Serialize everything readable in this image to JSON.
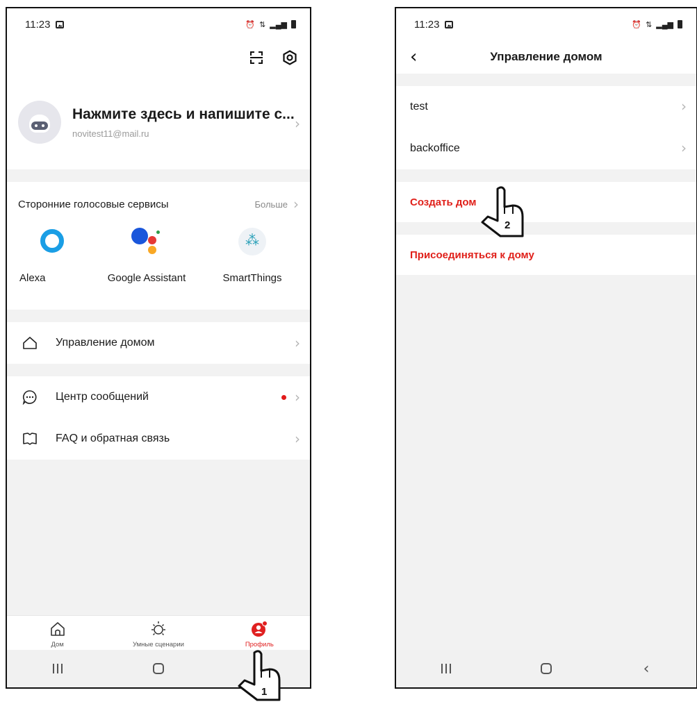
{
  "screen1": {
    "status": {
      "time": "11:23"
    },
    "profile": {
      "name": "Нажмите здесь и напишите с...",
      "email": "novitest11@mail.ru"
    },
    "voice": {
      "title": "Сторонние голосовые сервисы",
      "more": "Больше",
      "items": [
        {
          "label": "Alexa",
          "icon": "alexa-icon"
        },
        {
          "label": "Google Assistant",
          "icon": "google-assistant-icon"
        },
        {
          "label": "SmartThings",
          "icon": "smartthings-icon"
        }
      ]
    },
    "menu": [
      {
        "label": "Управление домом",
        "icon": "home-outline-icon"
      },
      {
        "label": "Центр сообщений",
        "icon": "chat-bubble-icon",
        "has_dot": true
      },
      {
        "label": "FAQ и обратная связь",
        "icon": "book-icon"
      }
    ],
    "bottom_nav": [
      {
        "label": "Дом",
        "icon": "home-icon",
        "active": false
      },
      {
        "label": "Умные сценарии",
        "icon": "sun-icon",
        "active": false
      },
      {
        "label": "Профиль",
        "icon": "profile-icon",
        "active": true
      }
    ]
  },
  "screen2": {
    "status": {
      "time": "11:23"
    },
    "title": "Управление домом",
    "homes": [
      "test",
      "backoffice"
    ],
    "actions": [
      "Создать дом",
      "Присоединяться к дому"
    ]
  },
  "callouts": [
    "1",
    "2"
  ],
  "colors": {
    "accent_red": "#e0201a",
    "alexa_blue": "#1a9ee5",
    "background_gray": "#f2f2f2"
  }
}
